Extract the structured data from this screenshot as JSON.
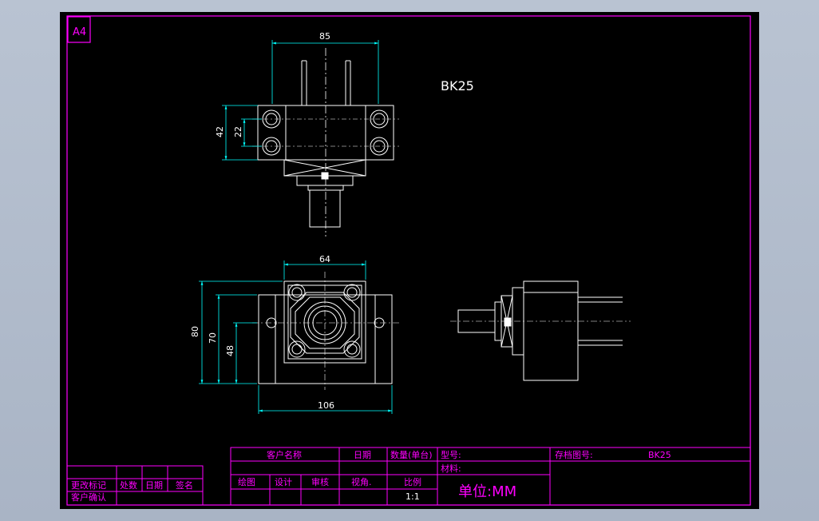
{
  "sheet": {
    "size_label": "A4"
  },
  "note": {
    "model": "BK25"
  },
  "dimensions": {
    "top_width": "85",
    "top_height_outer": "42",
    "top_height_inner": "22",
    "front_inner_width": "64",
    "front_outer_width": "106",
    "front_height_80": "80",
    "front_height_70": "70",
    "front_height_48": "48"
  },
  "title_block": {
    "customer_name": "客户名称",
    "date": "日期",
    "quantity": "数量(单台)",
    "model_no": "型号:",
    "drawing_no_label": "存档图号:",
    "drawing_no_value": "BK25",
    "material": "材料:",
    "drawn": "绘图",
    "design": "设计",
    "review": "审核",
    "view_angle": "视角.",
    "scale_label": "比例",
    "scale_value": "1:1",
    "unit": "单位:MM",
    "revision_mark": "更改标记",
    "count": "处数",
    "rev_date": "日期",
    "signature": "签名",
    "customer_confirm": "客户确认"
  },
  "colors": {
    "background": "#000000",
    "frame": "#ff00ff",
    "drawing": "#ffffff",
    "dimension": "#00ffff",
    "text": "#ff00ff"
  }
}
